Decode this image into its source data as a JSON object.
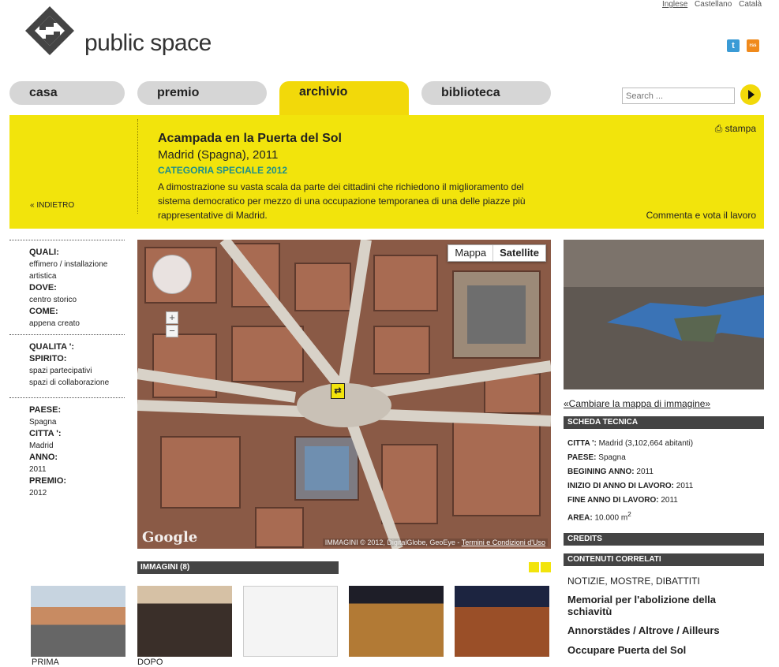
{
  "languages": [
    "Inglese",
    "Castellano",
    "Català"
  ],
  "brand": "public space",
  "social": {
    "twitter": "t",
    "rss": "rss"
  },
  "tabs": [
    "casa",
    "premio",
    "archivio",
    "biblioteca"
  ],
  "search": {
    "placeholder": "Search ..."
  },
  "banner": {
    "back": "« INDIETRO",
    "title": "Acampada en la Puerta del Sol",
    "subtitle": "Madrid (Spagna), 2011",
    "category": "CATEGORIA SPECIALE 2012",
    "description": "A dimostrazione su vasta scala da parte dei cittadini che richiedono il miglioramento del sistema democratico per mezzo di una occupazione temporanea di una delle piazze più rappresentative di Madrid.",
    "print": "stampa",
    "comment": "Commenta e vota il lavoro"
  },
  "meta": {
    "quali_label": "QUALI:",
    "quali_value": "effimero / installazione artistica",
    "dove_label": "DOVE:",
    "dove_value": "centro storico",
    "come_label": "COME:",
    "come_value": "appena creato",
    "qualita_label": "QUALITA ':",
    "spirito_label": "SPIRITO:",
    "spirito_1": "spazi partecipativi",
    "spirito_2": "spazi di collaborazione",
    "paese_label": "PAESE:",
    "paese_value": "Spagna",
    "citta_label": "CITTA ':",
    "citta_value": "Madrid",
    "anno_label": "ANNO:",
    "anno_value": "2011",
    "premio_label": "PREMIO:",
    "premio_value": "2012"
  },
  "map": {
    "mappa": "Mappa",
    "satellite": "Satellite",
    "google": "Google",
    "copyright": "IMMAGINI © 2012, DigitalGlobe, GeoEye -",
    "terms": "Termini e Condizioni d'Uso"
  },
  "images": {
    "title": "IMMAGINI (8)",
    "captions": [
      "PRIMA",
      "DOPO"
    ]
  },
  "right": {
    "change_map": "«Cambiare la mappa di immagine»",
    "scheda": "SCHEDA TECNICA",
    "citta_label": "CITTA ':",
    "citta_value": "Madrid (3,102,664 abitanti)",
    "paese_label": "PAESE:",
    "paese_value": "Spagna",
    "begining_label": "BEGINING ANNO:",
    "begining_value": "2011",
    "inizio_label": "INIZIO DI ANNO DI LAVORO:",
    "inizio_value": "2011",
    "fine_label": "FINE ANNO DI LAVORO:",
    "fine_value": "2011",
    "area_label": "AREA:",
    "area_value": "10.000 m",
    "area_sup": "2",
    "credits": "CREDITS",
    "contenuti": "CONTENUTI CORRELATI",
    "related_sub": "NOTIZIE, MOSTRE, DIBATTITI",
    "related": [
      "Memorial per l'abolizione della schiavitù",
      "Annorstädes / Altrove / Ailleurs",
      "Occupare Puerta del Sol"
    ]
  }
}
